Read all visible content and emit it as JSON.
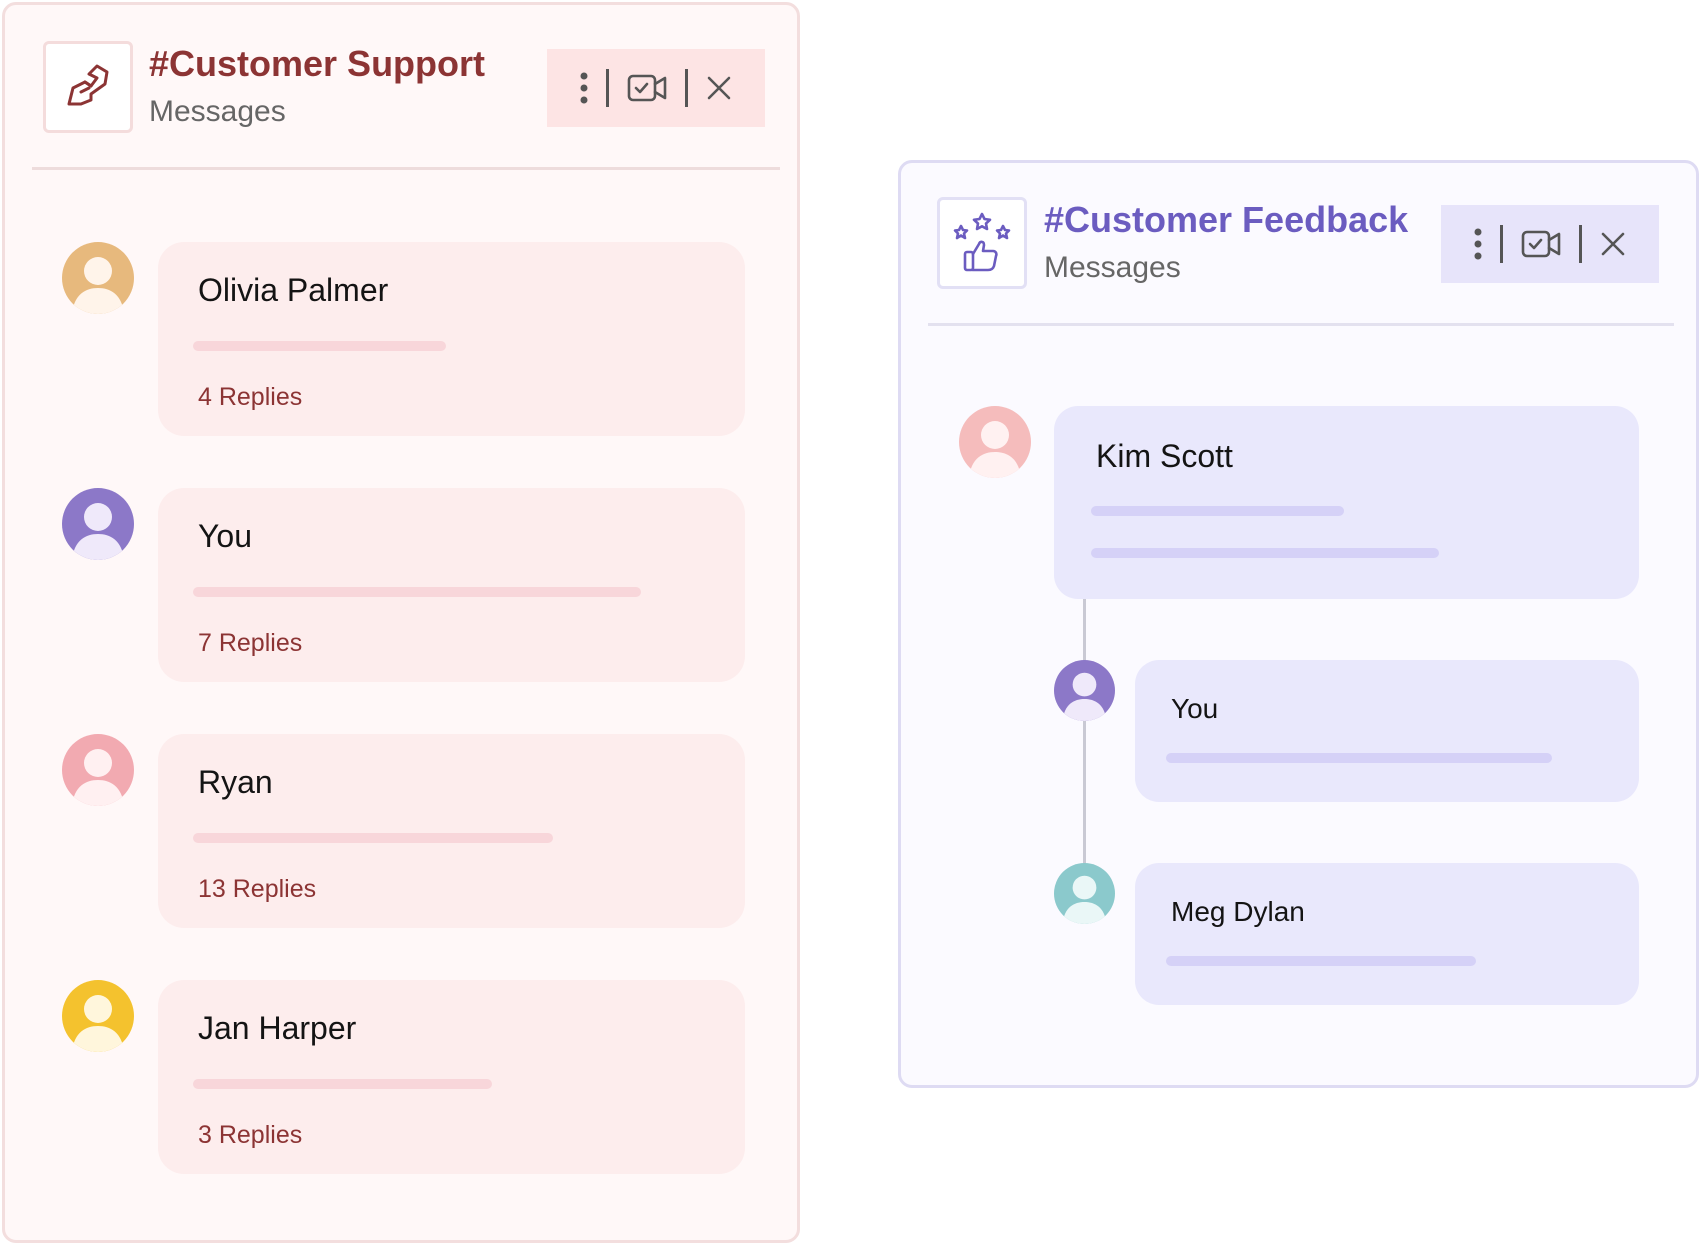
{
  "support": {
    "title": "#Customer Support",
    "subtitle": "Messages",
    "threads": [
      {
        "name": "Olivia Palmer",
        "replies": "4 Replies"
      },
      {
        "name": "You",
        "replies": "7 Replies"
      },
      {
        "name": "Ryan",
        "replies": "13 Replies"
      },
      {
        "name": "Jan Harper",
        "replies": "3 Replies"
      }
    ]
  },
  "feedback": {
    "title": "#Customer Feedback",
    "subtitle": "Messages",
    "thread": [
      {
        "name": "Kim Scott"
      },
      {
        "name": "You"
      },
      {
        "name": "Meg Dylan"
      }
    ]
  },
  "icons": {
    "support_logo": "handshake-icon",
    "feedback_logo": "thumbs-up-stars-icon",
    "more": "more-vertical-icon",
    "video": "video-call-icon",
    "close": "close-icon"
  },
  "colors": {
    "support_accent": "#8c3434",
    "feedback_accent": "#6b5cc0",
    "support_card": "#fdeded",
    "feedback_card": "#e9e8fc"
  }
}
